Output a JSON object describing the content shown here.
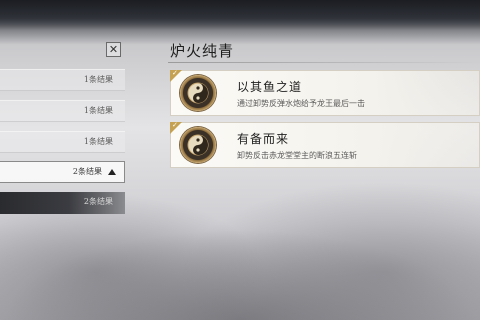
{
  "left_panel": {
    "close_glyph": "✕",
    "rows": [
      {
        "count": "1条结果"
      },
      {
        "count": "1条结果"
      },
      {
        "count": "1条结果"
      },
      {
        "count": "2条结果",
        "expanded": true
      },
      {
        "count": "2条结果"
      }
    ]
  },
  "section": {
    "title": "炉火纯青",
    "achievements": [
      {
        "name": "以其鱼之道",
        "description": "通过卸势反弹水炮给予龙王最后一击",
        "completed": true,
        "icon": "yin-yang-medal-icon"
      },
      {
        "name": "有备而来",
        "description": "卸势反击赤龙堂堂主的断浪五连斩",
        "completed": true,
        "icon": "yin-yang-medal-icon"
      }
    ]
  },
  "colors": {
    "gold_accent": "#c5a253",
    "medal_dark": "#3b3126",
    "text_dark": "#1f1f1f"
  }
}
